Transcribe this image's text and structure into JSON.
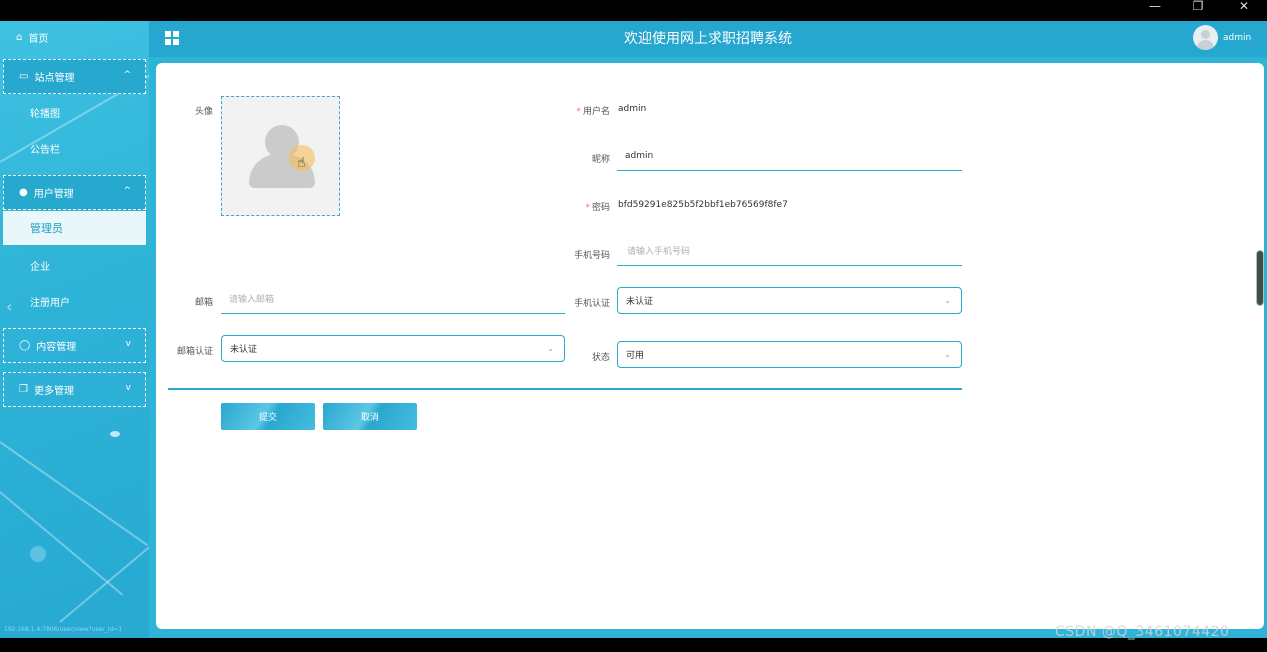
{
  "window": {
    "minimize": "—",
    "restore": "❐",
    "close": "✕"
  },
  "sidebar": {
    "home": "首页",
    "groups": [
      {
        "label": "站点管理",
        "items": [
          "轮播图",
          "公告栏"
        ]
      },
      {
        "label": "用户管理",
        "items": [
          "管理员",
          "企业",
          "注册用户"
        ]
      },
      {
        "label": "内容管理"
      },
      {
        "label": "更多管理"
      }
    ],
    "selected_item": "管理员",
    "status_url": "192.168.1.4:7806/user/view?user_id=1"
  },
  "header": {
    "title": "欢迎使用网上求职招聘系统",
    "user": "admin"
  },
  "form": {
    "avatar_label": "头像",
    "username_label": "用户名",
    "username_value": "admin",
    "nickname_label": "昵称",
    "nickname_value": "admin",
    "password_label": "密码",
    "password_value": "bfd59291e825b5f2bbf1eb76569f8fe7",
    "phone_label": "手机号码",
    "phone_placeholder": "请输入手机号码",
    "email_label": "邮箱",
    "email_placeholder": "请输入邮箱",
    "phone_verify_label": "手机认证",
    "phone_verify_value": "未认证",
    "email_verify_label": "邮箱认证",
    "email_verify_value": "未认证",
    "status_label": "状态",
    "status_value": "可用",
    "submit": "提交",
    "cancel": "取消"
  },
  "watermark": "CSDN @Q_3461074420",
  "colors": {
    "accent": "#2aa7c9",
    "sidebar": "#2fb4d8",
    "header": "#25a7cf",
    "required": "#f56c6c"
  }
}
